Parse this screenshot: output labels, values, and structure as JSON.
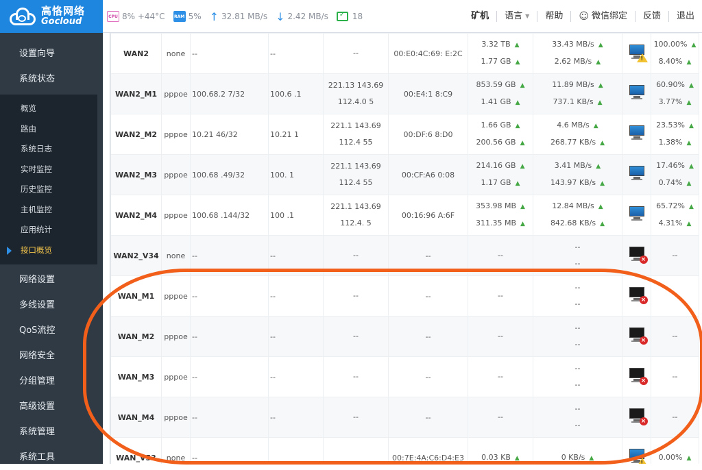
{
  "logo": {
    "cn": "高恪网络",
    "en": "Gocloud"
  },
  "stats": {
    "cpu_chip": "CPU",
    "cpu": "8% +44°C",
    "ram_chip": "RAM",
    "ram": "5%",
    "upload": "32.81 MB/s",
    "download": "2.42 MB/s",
    "online": "18"
  },
  "nav": {
    "miner": "矿机",
    "language": "语言",
    "help": "帮助",
    "wechat": "微信绑定",
    "feedback": "反馈",
    "logout": "退出"
  },
  "sidebar": {
    "items_top": [
      "设置向导",
      "系统状态"
    ],
    "sub_items": [
      "概览",
      "路由",
      "系统日志",
      "实时监控",
      "历史监控",
      "主机监控",
      "应用统计",
      "接口概览"
    ],
    "items_bottom": [
      "网络设置",
      "多线设置",
      "QoS流控",
      "网络安全",
      "分组管理",
      "高级设置",
      "系统管理",
      "系统工具"
    ]
  },
  "table": {
    "rows": [
      {
        "name": "WAN2",
        "proto": "none",
        "ip": "--",
        "gw": "--",
        "dns1": "--",
        "dns2": "",
        "mac": "00:E0:4C:69:  E:2C",
        "tx": "3.32 TB",
        "rx": "1.77 GB",
        "up": "33.43 MB/s",
        "dn": "2.62 MB/s",
        "status": "warn",
        "p1": "100.00%",
        "p2": "8.40%"
      },
      {
        "name": "WAN2_M1",
        "proto": "pppoe",
        "ip": "100.68.2   7/32",
        "gw": "100.6   .1",
        "dns1": "221.13   143.69",
        "dns2": "112.4.0   5",
        "mac": "00:E4:1    8:C9",
        "tx": "853.59 GB",
        "rx": "1.41 GB",
        "up": "11.89 MB/s",
        "dn": "737.1 KB/s",
        "status": "on",
        "p1": "60.90%",
        "p2": "3.77%"
      },
      {
        "name": "WAN2_M2",
        "proto": "pppoe",
        "ip": "10.21     46/32",
        "gw": "10.21     1",
        "dns1": "221.1   143.69",
        "dns2": "112.4   55",
        "mac": "00:DF:6    8:D0",
        "tx": "1.66 GB",
        "rx": "200.56 GB",
        "up": "4.6 MB/s",
        "dn": "268.77 KB/s",
        "status": "on",
        "p1": "23.53%",
        "p2": "1.38%"
      },
      {
        "name": "WAN2_M3",
        "proto": "pppoe",
        "ip": "100.68   .49/32",
        "gw": "100.    1",
        "dns1": "221.1   143.69",
        "dns2": "112.4   55",
        "mac": "00:CF:A6    0:08",
        "tx": "214.16 GB",
        "rx": "1.17 GB",
        "up": "3.41 MB/s",
        "dn": "143.97 KB/s",
        "status": "on",
        "p1": "17.46%",
        "p2": "0.74%"
      },
      {
        "name": "WAN2_M4",
        "proto": "pppoe",
        "ip": "100.68   .144/32",
        "gw": "100   .1",
        "dns1": "221.1   143.69",
        "dns2": "112.4.   5",
        "mac": "00:16:96    A:6F",
        "tx": "353.98 MB",
        "rx": "311.35 MB",
        "up": "12.84 MB/s",
        "dn": "842.68 KB/s",
        "status": "on",
        "p1": "65.72%",
        "p2": "4.31%"
      },
      {
        "name": "WAN2_V34",
        "proto": "none",
        "ip": "--",
        "gw": "--",
        "dns1": "--",
        "dns2": "",
        "mac": "--",
        "tx": "--",
        "rx": "",
        "up": "--",
        "dn": "--",
        "status": "off",
        "p1": "--",
        "p2": ""
      },
      {
        "name": "WAN_M1",
        "proto": "pppoe",
        "ip": "--",
        "gw": "--",
        "dns1": "--",
        "dns2": "",
        "mac": "--",
        "tx": "--",
        "rx": "",
        "up": "--",
        "dn": "--",
        "status": "off",
        "p1": "",
        "p2": ""
      },
      {
        "name": "WAN_M2",
        "proto": "pppoe",
        "ip": "--",
        "gw": "--",
        "dns1": "--",
        "dns2": "",
        "mac": "--",
        "tx": "--",
        "rx": "",
        "up": "--",
        "dn": "--",
        "status": "off",
        "p1": "--",
        "p2": ""
      },
      {
        "name": "WAN_M3",
        "proto": "pppoe",
        "ip": "--",
        "gw": "--",
        "dns1": "--",
        "dns2": "",
        "mac": "--",
        "tx": "--",
        "rx": "",
        "up": "--",
        "dn": "--",
        "status": "off",
        "p1": "--",
        "p2": ""
      },
      {
        "name": "WAN_M4",
        "proto": "pppoe",
        "ip": "--",
        "gw": "--",
        "dns1": "--",
        "dns2": "",
        "mac": "--",
        "tx": "--",
        "rx": "",
        "up": "--",
        "dn": "--",
        "status": "off",
        "p1": "--",
        "p2": ""
      },
      {
        "name": "WAN_V53",
        "proto": "none",
        "ip": "--",
        "gw": "",
        "dns1": "",
        "dns2": "",
        "mac": "00:7E:4A:C6:D4:E3",
        "tx": "0.03 KB",
        "rx": "",
        "up": "0 KB/s",
        "dn": "",
        "status": "warn",
        "p1": "0.00%",
        "p2": ""
      }
    ]
  },
  "colors": {
    "accent": "#1f86e0",
    "sidebar": "#2f3a45",
    "annotation": "#f25f1a"
  }
}
